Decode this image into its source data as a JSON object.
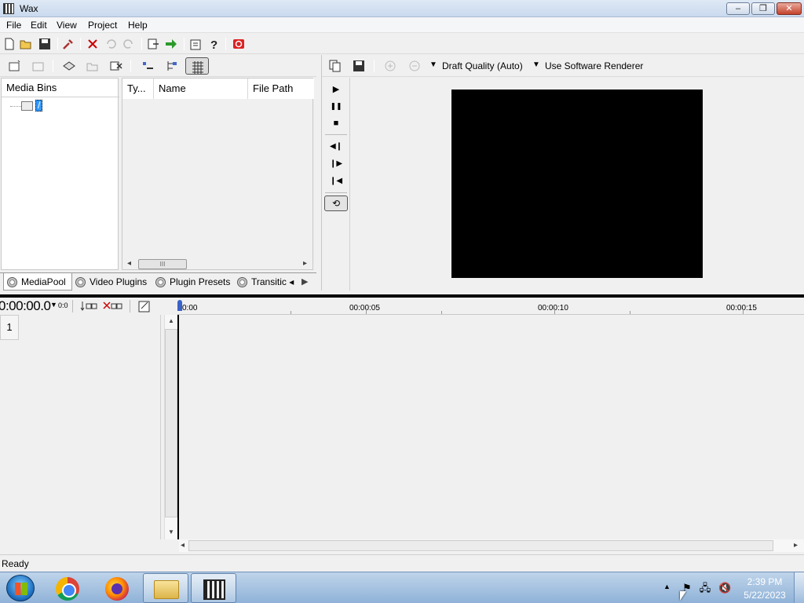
{
  "window": {
    "title": "Wax",
    "buttons": {
      "minimize": "–",
      "maximize": "❐",
      "close": "✕"
    }
  },
  "menu": [
    "File",
    "Edit",
    "View",
    "Project",
    "Help"
  ],
  "toolbar": {
    "icons": [
      "new-icon",
      "open-icon",
      "save-icon",
      "wrench-icon",
      "delete-icon",
      "undo-icon",
      "redo-icon",
      "export-icon",
      "go-icon",
      "properties-icon",
      "help-icon",
      "record-icon"
    ]
  },
  "media_toolbar": {
    "icons": [
      "new-bin-icon",
      "bin-up-icon",
      "import-icon",
      "open-folder-icon",
      "remove-icon",
      "sort-icon",
      "tree-icon",
      "grid-icon"
    ]
  },
  "media_bins": {
    "header": "Media Bins",
    "root_label": "/"
  },
  "file_list": {
    "columns": [
      "Ty...",
      "Name",
      "File Path"
    ],
    "scroll_glyph": "III"
  },
  "panel_tabs": [
    {
      "label": "MediaPool",
      "active": true
    },
    {
      "label": "Video Plugins",
      "active": false
    },
    {
      "label": "Plugin Presets",
      "active": false
    },
    {
      "label": "Transitic ◂",
      "active": false
    }
  ],
  "preview": {
    "quality": "Draft Quality (Auto)",
    "renderer": "Use Software Renderer",
    "transport": [
      "▶",
      "❚❚",
      "■",
      "◀❙",
      "❙▶",
      "❙◀"
    ],
    "loop": "⟲"
  },
  "timeline": {
    "timecode": "0:00:00.0",
    "small_label": "0:0",
    "ruler": [
      "0:00",
      "00:00:05",
      "00:00:10",
      "00:00:15"
    ],
    "track_number": "1"
  },
  "status": {
    "text": "Ready"
  },
  "taskbar": {
    "time": "2:39 PM",
    "date": "5/22/2023",
    "tray_up": "▲"
  }
}
